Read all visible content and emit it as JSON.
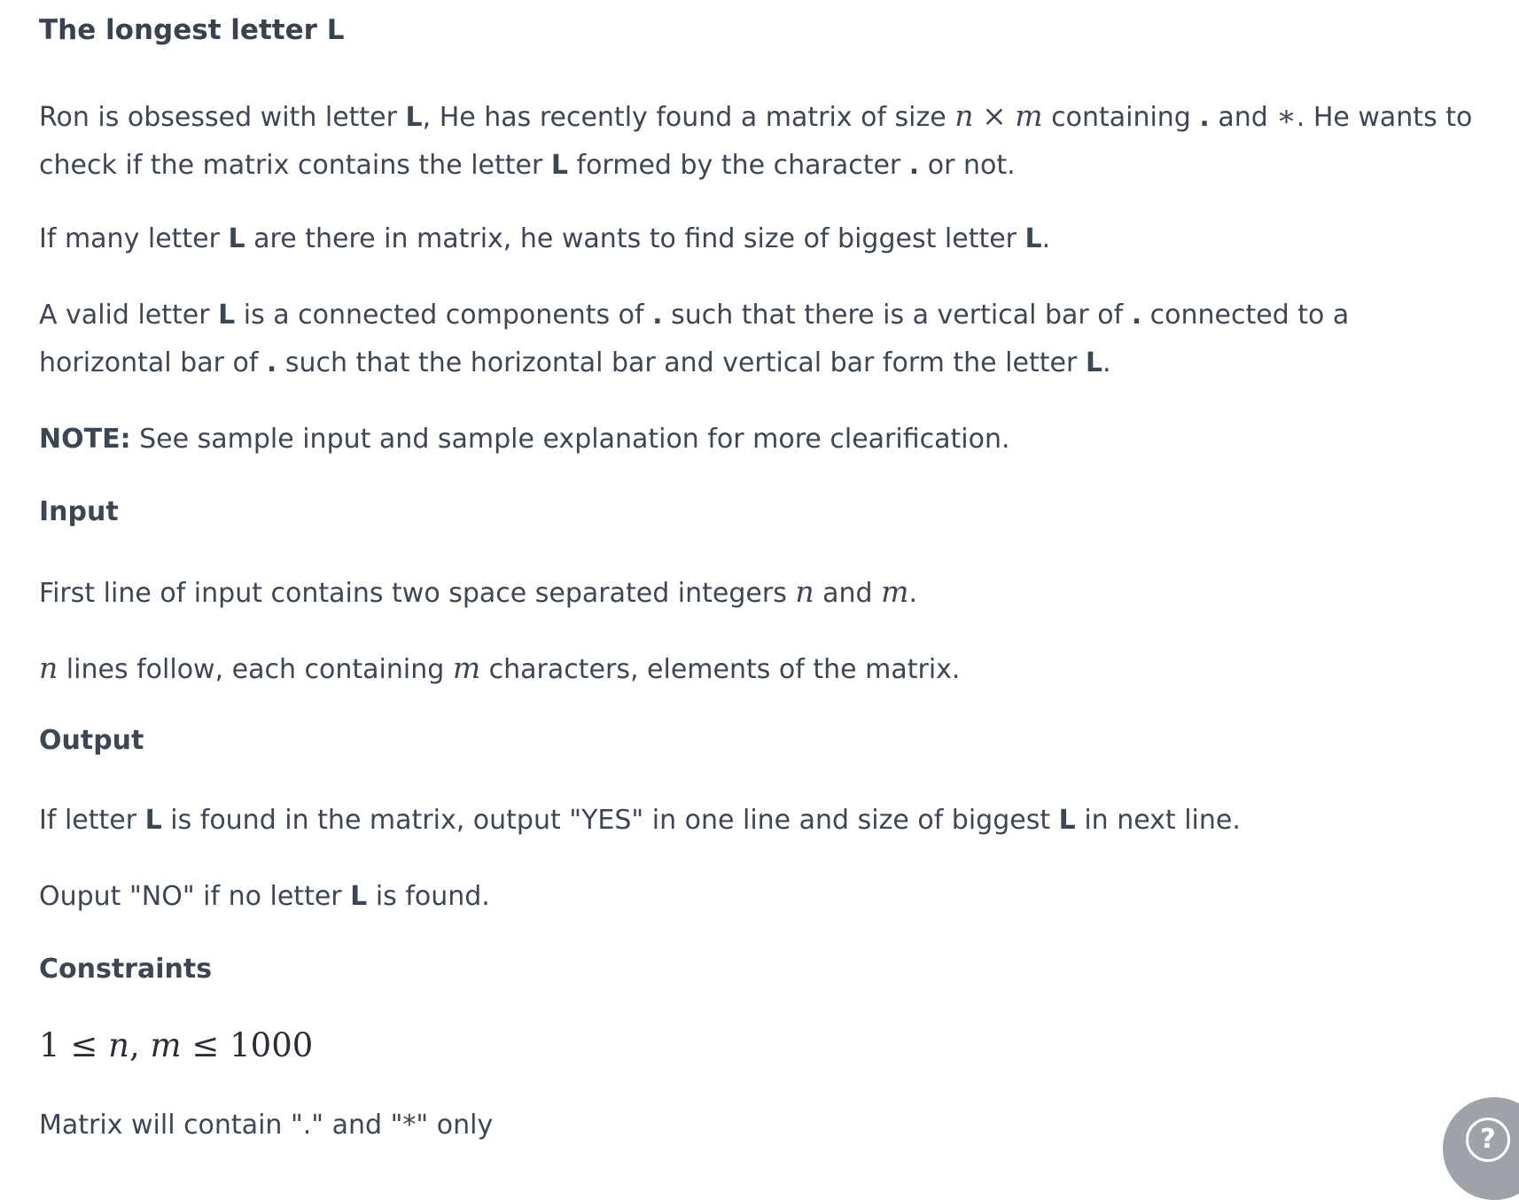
{
  "title": "The longest letter L",
  "p1": {
    "t1": "Ron is obsessed with letter ",
    "L": "L",
    "t2": ", He has recently found a matrix of size ",
    "n": "n",
    "times": "×",
    "m": "m",
    "t3": " containing ",
    "dot": ".",
    "t4": " and ",
    "star": "∗",
    "t5": ". He wants to",
    "line2a": "check if the matrix contains the letter ",
    "line2L": "L",
    "line2b": " formed by the character ",
    "line2dot": ".",
    "line2c": " or not."
  },
  "p2": {
    "t1": "If many letter ",
    "L1": "L",
    "t2": " are there in matrix, he wants to find size of biggest letter ",
    "L2": "L",
    "t3": "."
  },
  "p3": {
    "t1": "A valid letter ",
    "L1": "L",
    "t2": " is a connected components of ",
    "dot1": ".",
    "t3": " such that there is a vertical bar of ",
    "dot2": ".",
    "t4": " connected to a",
    "line2a": "horizontal bar of ",
    "line2dot": ".",
    "line2b": " such that the horizontal bar and vertical bar form the letter ",
    "line2L": "L",
    "line2c": "."
  },
  "note": {
    "label": "NOTE:",
    "text": " See sample input and sample explanation for more clearification."
  },
  "input_heading": "Input",
  "input1": {
    "t1": "First line of input contains two space separated integers ",
    "n": "n",
    "t2": " and ",
    "m": "m",
    "t3": "."
  },
  "input2": {
    "n": "n",
    "t1": " lines follow, each containing ",
    "m": "m",
    "t2": " characters, elements of the matrix."
  },
  "output_heading": "Output",
  "output1": {
    "t1": "If letter ",
    "L1": "L",
    "t2": " is found in the matrix, output \"YES\" in one line and size of biggest ",
    "L2": "L",
    "t3": " in next line."
  },
  "output2": {
    "t1": "Ouput \"NO\" if no letter ",
    "L": "L",
    "t2": " is found."
  },
  "constraints_heading": "Constraints",
  "constraint": {
    "one": "1",
    "le1": "≤",
    "n": "n",
    "comma": ",",
    "m": "m",
    "le2": "≤",
    "max": "1000"
  },
  "matrix_note": "Matrix will contain \".\" and \"*\" only",
  "help_icon": "question-mark-icon",
  "help_label": "?"
}
